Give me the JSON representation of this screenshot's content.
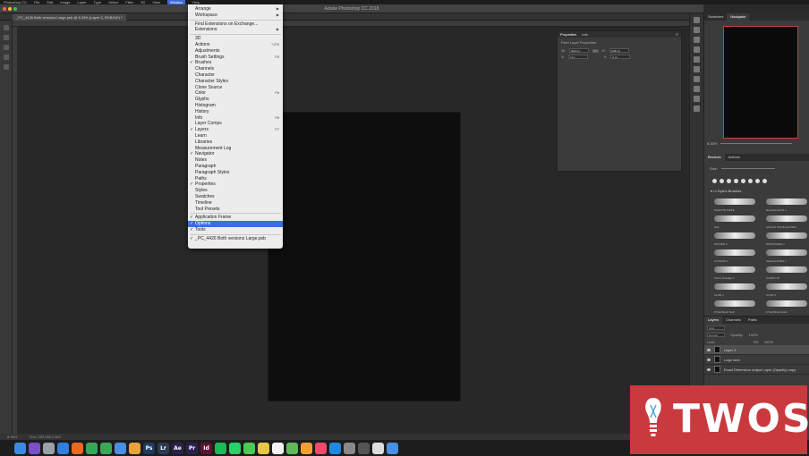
{
  "window": {
    "title": "Adobe Photoshop CC 2018",
    "doc_tab": "_PC_4426 Both versions Large.psb @ 8.33% (Layer 3, RGB/16*) *"
  },
  "menubar": {
    "items": [
      "Photoshop CC",
      "File",
      "Edit",
      "Image",
      "Layer",
      "Type",
      "Select",
      "Filter",
      "3D",
      "View",
      "Window",
      "Help"
    ],
    "active": "Window"
  },
  "window_menu": {
    "items": [
      {
        "label": "Arrange",
        "checked": false,
        "shortcut": "",
        "submenu": true
      },
      {
        "label": "Workspace",
        "checked": false,
        "shortcut": "",
        "submenu": true
      },
      {
        "sep": true
      },
      {
        "label": "Find Extensions on Exchange...",
        "checked": false,
        "shortcut": ""
      },
      {
        "label": "Extensions",
        "checked": false,
        "shortcut": "",
        "submenu": true
      },
      {
        "sep": true
      },
      {
        "label": "3D",
        "checked": false,
        "shortcut": ""
      },
      {
        "label": "Actions",
        "checked": false,
        "shortcut": "⌥F9"
      },
      {
        "label": "Adjustments",
        "checked": false,
        "shortcut": ""
      },
      {
        "label": "Brush Settings",
        "checked": false,
        "shortcut": "F5"
      },
      {
        "label": "Brushes",
        "checked": true,
        "shortcut": ""
      },
      {
        "label": "Channels",
        "checked": false,
        "shortcut": ""
      },
      {
        "label": "Character",
        "checked": false,
        "shortcut": ""
      },
      {
        "label": "Character Styles",
        "checked": false,
        "shortcut": ""
      },
      {
        "label": "Clone Source",
        "checked": false,
        "shortcut": ""
      },
      {
        "label": "Color",
        "checked": false,
        "shortcut": "F6"
      },
      {
        "label": "Glyphs",
        "checked": false,
        "shortcut": ""
      },
      {
        "label": "Histogram",
        "checked": false,
        "shortcut": ""
      },
      {
        "label": "History",
        "checked": false,
        "shortcut": ""
      },
      {
        "label": "Info",
        "checked": false,
        "shortcut": "F8"
      },
      {
        "label": "Layer Comps",
        "checked": false,
        "shortcut": ""
      },
      {
        "label": "Layers",
        "checked": true,
        "shortcut": "F7"
      },
      {
        "label": "Learn",
        "checked": false,
        "shortcut": ""
      },
      {
        "label": "Libraries",
        "checked": false,
        "shortcut": ""
      },
      {
        "label": "Measurement Log",
        "checked": false,
        "shortcut": ""
      },
      {
        "label": "Navigator",
        "checked": true,
        "shortcut": ""
      },
      {
        "label": "Notes",
        "checked": false,
        "shortcut": ""
      },
      {
        "label": "Paragraph",
        "checked": false,
        "shortcut": ""
      },
      {
        "label": "Paragraph Styles",
        "checked": false,
        "shortcut": ""
      },
      {
        "label": "Paths",
        "checked": false,
        "shortcut": ""
      },
      {
        "label": "Properties",
        "checked": true,
        "shortcut": ""
      },
      {
        "label": "Styles",
        "checked": false,
        "shortcut": ""
      },
      {
        "label": "Swatches",
        "checked": false,
        "shortcut": ""
      },
      {
        "label": "Timeline",
        "checked": false,
        "shortcut": ""
      },
      {
        "label": "Tool Presets",
        "checked": false,
        "shortcut": ""
      },
      {
        "sep": true
      },
      {
        "label": "Application Frame",
        "checked": true,
        "shortcut": ""
      },
      {
        "label": "Options",
        "checked": true,
        "shortcut": "",
        "highlight": true
      },
      {
        "label": "Tools",
        "checked": true,
        "shortcut": ""
      },
      {
        "sep": true
      },
      {
        "label": "_PC_4426 Both versions Large.psb",
        "checked": true,
        "shortcut": ""
      }
    ]
  },
  "properties": {
    "tabs": [
      "Properties",
      "Info"
    ],
    "subtitle": "Pixel Layer Properties",
    "w_label": "W:",
    "w_value": "3020 px",
    "go_label": "GO",
    "h_label": "H:",
    "h_value": "4480 px",
    "x_label": "X:",
    "x_value": "0 px",
    "y_label": "Y:",
    "y_value": "0 px"
  },
  "navigator": {
    "tabs": [
      "Swatches",
      "Navigator"
    ],
    "zoom": "8.33%"
  },
  "brushes": {
    "tabs": [
      "Brushes",
      "Actions"
    ],
    "size_label": "Size:",
    "folder": "Kyle's Brushes",
    "items": [
      "PALETTE KNIFE",
      "Hard Round 16 1",
      "Soft",
      "Airbrush Soft Round 50%",
      "DUSTER 2",
      "SCRATCHES 1",
      "CLOUDS 1",
      "Jacked Ink Blot 1",
      "Fuzzy Smudge 3",
      "CLOUD 15",
      "CLOD 1",
      "CLOD 3",
      "KYLE Brush Soft",
      "KYLE Brush Hard"
    ]
  },
  "layers": {
    "tabs": [
      "Layers",
      "Channels",
      "Paths"
    ],
    "kind_label": "Kind",
    "blend": "Normal",
    "opacity_label": "Opacity:",
    "opacity": "100%",
    "lock_label": "Lock:",
    "fill_label": "Fill:",
    "fill": "100%",
    "rows": [
      {
        "name": "Layer 3",
        "selected": true
      },
      {
        "name": "Logo sent",
        "selected": false
      },
      {
        "name": "Exact Dimension output Layer (Opacity) copy",
        "selected": false
      }
    ]
  },
  "status": {
    "zoom": "8.33%",
    "doc": "Doc: 293.2M/1.01G"
  },
  "dock_apps": [
    {
      "name": "finder",
      "label": "",
      "color": "#3c8be0"
    },
    {
      "name": "siri",
      "label": "",
      "color": "#7a4fc9"
    },
    {
      "name": "launchpad",
      "label": "",
      "color": "#9aa0a8"
    },
    {
      "name": "safari",
      "label": "",
      "color": "#2d7fe0"
    },
    {
      "name": "firefox",
      "label": "",
      "color": "#e66a22"
    },
    {
      "name": "chrome",
      "label": "",
      "color": "#3aa757"
    },
    {
      "name": "chrome-2",
      "label": "",
      "color": "#3aa757"
    },
    {
      "name": "mail",
      "label": "",
      "color": "#4a90e2"
    },
    {
      "name": "photos",
      "label": "",
      "color": "#e8a23b"
    },
    {
      "name": "photoshop",
      "label": "Ps",
      "color": "#1f3a60"
    },
    {
      "name": "lightroom",
      "label": "Lr",
      "color": "#2b3b55"
    },
    {
      "name": "after-effects",
      "label": "Ae",
      "color": "#2c1f4f"
    },
    {
      "name": "premiere",
      "label": "Pr",
      "color": "#2c1f4f"
    },
    {
      "name": "indesign",
      "label": "Id",
      "color": "#5e1434"
    },
    {
      "name": "spotify",
      "label": "",
      "color": "#1db954"
    },
    {
      "name": "whatsapp",
      "label": "",
      "color": "#25d366"
    },
    {
      "name": "messages",
      "label": "",
      "color": "#4ac957"
    },
    {
      "name": "notes",
      "label": "",
      "color": "#e8c547"
    },
    {
      "name": "calendar",
      "label": "",
      "color": "#f2f2f2"
    },
    {
      "name": "maps",
      "label": "",
      "color": "#5fb85a"
    },
    {
      "name": "photos-2",
      "label": "",
      "color": "#f0a030"
    },
    {
      "name": "music",
      "label": "",
      "color": "#f24a6b"
    },
    {
      "name": "appstore",
      "label": "",
      "color": "#1e88e5"
    },
    {
      "name": "settings",
      "label": "",
      "color": "#8a8a8a"
    },
    {
      "name": "utilities",
      "label": "",
      "color": "#555"
    },
    {
      "name": "textedit",
      "label": "",
      "color": "#ddd"
    },
    {
      "name": "downloads",
      "label": "",
      "color": "#4a90e2"
    }
  ],
  "watermark": {
    "text": "TWOS",
    "bg": "#c93a3e"
  },
  "colors": {
    "highlight": "#3a6fe0",
    "nav_border": "#d03a3a"
  }
}
